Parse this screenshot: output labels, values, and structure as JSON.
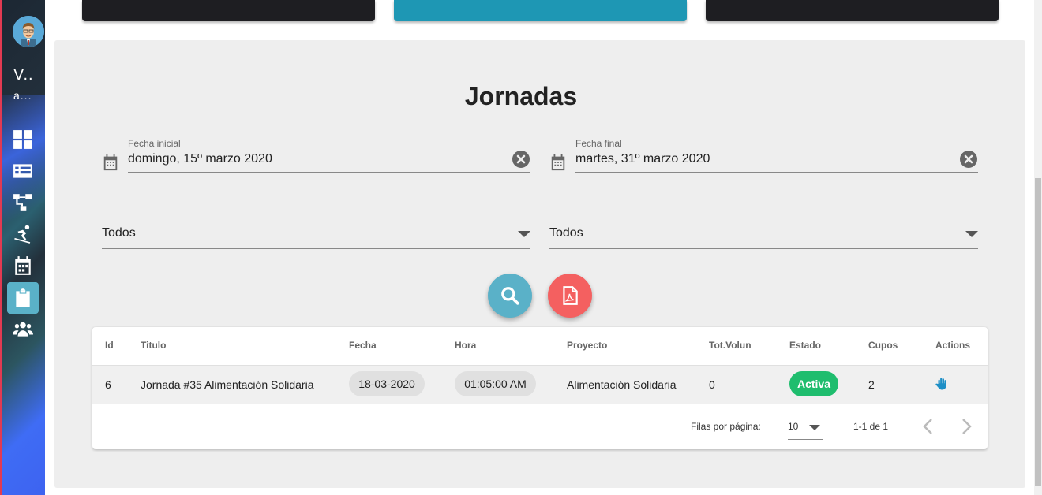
{
  "sidebar": {
    "user_name": "V..",
    "user_sub": "a...",
    "items": [
      {
        "icon": "dashboard-icon",
        "active": false
      },
      {
        "icon": "list-icon",
        "active": false
      },
      {
        "icon": "sitemap-icon",
        "active": false
      },
      {
        "icon": "snowboarder-icon",
        "active": false
      },
      {
        "icon": "calendar-icon",
        "active": false
      },
      {
        "icon": "clipboard-icon",
        "active": true
      },
      {
        "icon": "users-icon",
        "active": false
      }
    ]
  },
  "colors": {
    "accent": "#5ab1c8",
    "pdf": "#f46060",
    "active_badge": "#1fbd6e",
    "card_teal": "#1e97b4",
    "card_dark": "#1e1e22"
  },
  "page": {
    "title": "Jornadas"
  },
  "filters": {
    "start_label": "Fecha inicial",
    "start_value": "domingo, 15º marzo 2020",
    "end_label": "Fecha final",
    "end_value": "martes, 31º marzo 2020",
    "select1_value": "Todos",
    "select2_value": "Todos"
  },
  "table": {
    "headers": [
      "Id",
      "Titulo",
      "Fecha",
      "Hora",
      "Proyecto",
      "Tot.Volun",
      "Estado",
      "Cupos",
      "Actions"
    ],
    "rows": [
      {
        "id": "6",
        "titulo": "Jornada #35 Alimentación Solidaria",
        "fecha": "18-03-2020",
        "hora": "01:05:00 AM",
        "proyecto": "Alimentación Solidaria",
        "tot_volun": "0",
        "estado": "Activa",
        "cupos": "2",
        "action_icon": "hand-icon"
      }
    ],
    "footer": {
      "rows_per_page_label": "Filas por página:",
      "rows_per_page_value": "10",
      "range": "1-1 de 1"
    }
  }
}
